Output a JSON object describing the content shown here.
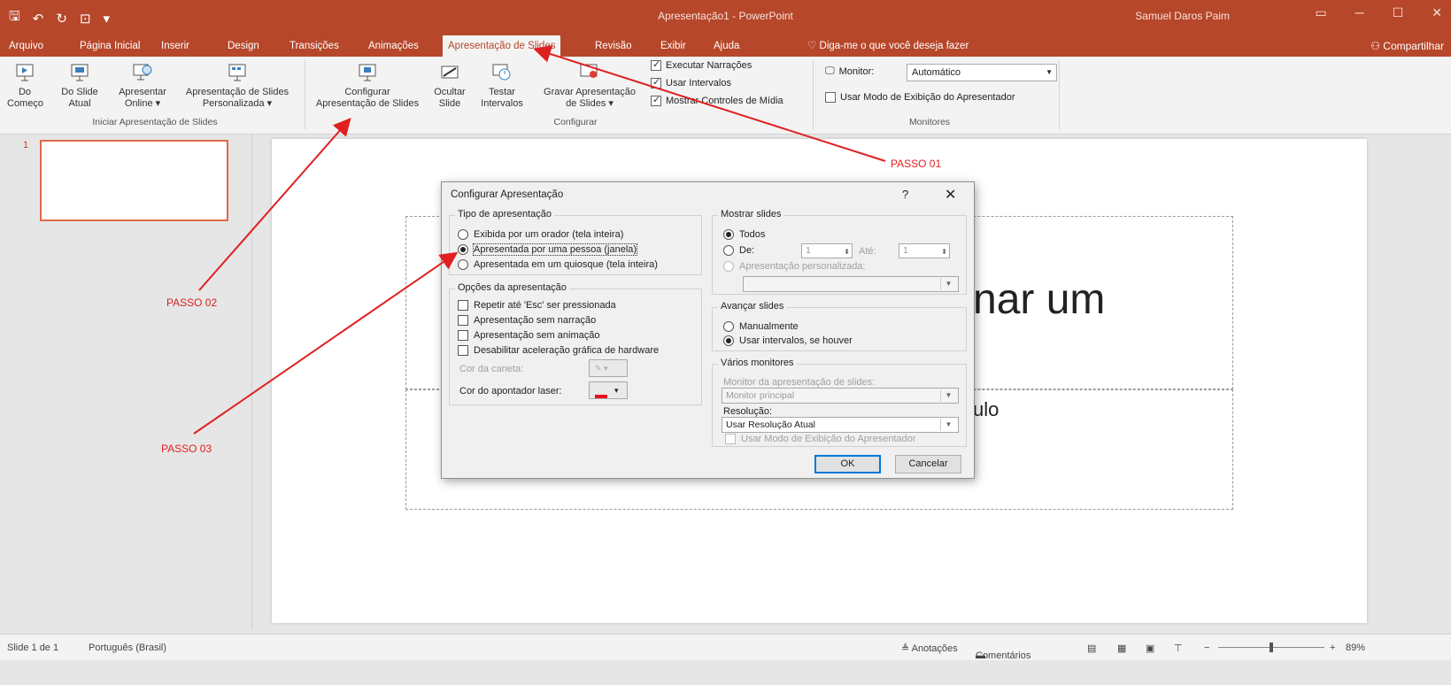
{
  "window": {
    "title": "Apresentação1 - PowerPoint",
    "user": "Samuel Daros Paim"
  },
  "tabs": [
    {
      "label": "Arquivo"
    },
    {
      "label": "Página Inicial"
    },
    {
      "label": "Inserir"
    },
    {
      "label": "Design"
    },
    {
      "label": "Transições"
    },
    {
      "label": "Animações"
    },
    {
      "label": "Apresentação de Slides",
      "active": true
    },
    {
      "label": "Revisão"
    },
    {
      "label": "Exibir"
    },
    {
      "label": "Ajuda"
    }
  ],
  "tellme": "Diga-me o que você deseja fazer",
  "share": "Compartilhar",
  "ribbon": {
    "start": {
      "from_begin": [
        "Do",
        "Começo"
      ],
      "from_current": [
        "Do Slide",
        "Atual"
      ],
      "online": [
        "Apresentar",
        "Online ▾"
      ],
      "custom": [
        "Apresentação de Slides",
        "Personalizada ▾"
      ],
      "group": "Iniciar Apresentação de Slides"
    },
    "setup": {
      "configure": [
        "Configurar",
        "Apresentação de Slides"
      ],
      "hide": [
        "Ocultar",
        "Slide"
      ],
      "rehearse": [
        "Testar",
        "Intervalos"
      ],
      "record": [
        "Gravar Apresentação",
        "de Slides ▾"
      ],
      "play_narrations": "Executar Narrações",
      "use_timings": "Usar Intervalos",
      "show_media_controls": "Mostrar Controles de Mídia",
      "group": "Configurar"
    },
    "monitors": {
      "monitor_label": "Monitor:",
      "monitor_value": "Automático",
      "presenter_view": "Usar Modo de Exibição do Apresentador",
      "group": "Monitores"
    }
  },
  "slide_pane": {
    "number": "1"
  },
  "slide": {
    "title_fragment": "nar um",
    "subtitle_fragment": "ulo"
  },
  "annotations": {
    "step1": "PASSO 01",
    "step2": "PASSO 02",
    "step3": "PASSO 03",
    "color": "#e02020"
  },
  "dialog": {
    "title": "Configurar Apresentação",
    "help": "?",
    "close": "✕",
    "show_type": {
      "legend": "Tipo de apresentação",
      "options": [
        "Exibida por um orador (tela inteira)",
        "Apresentada por uma pessoa (janela)",
        "Apresentada em um quiosque (tela inteira)"
      ]
    },
    "show_options": {
      "legend": "Opções da apresentação",
      "checks": [
        "Repetir até 'Esc' ser pressionada",
        "Apresentação sem narração",
        "Apresentação sem animação",
        "Desabilitar aceleração gráfica de hardware"
      ],
      "pen_color": "Cor da caneta:",
      "laser_color": "Cor do apontador laser:",
      "laser_swatch": "#e81123"
    },
    "show_slides": {
      "legend": "Mostrar slides",
      "all": "Todos",
      "from": "De:",
      "from_value": "1",
      "to": "Até:",
      "to_value": "1",
      "custom": "Apresentação personalizada:"
    },
    "advance": {
      "legend": "Avançar slides",
      "manual": "Manualmente",
      "timings": "Usar intervalos, se houver"
    },
    "multi_monitor": {
      "legend": "Vários monitores",
      "monitor_label": "Monitor da apresentação de slides:",
      "monitor_value": "Monitor principal",
      "resolution_label": "Resolução:",
      "resolution_value": "Usar Resolução Atual",
      "presenter_view": "Usar Modo de Exibição do Apresentador"
    },
    "ok": "OK",
    "cancel": "Cancelar"
  },
  "status": {
    "slide": "Slide 1 de 1",
    "language": "Português (Brasil)",
    "notes": "≜ Anotações",
    "comments": "Comentários",
    "zoom": "89%"
  }
}
